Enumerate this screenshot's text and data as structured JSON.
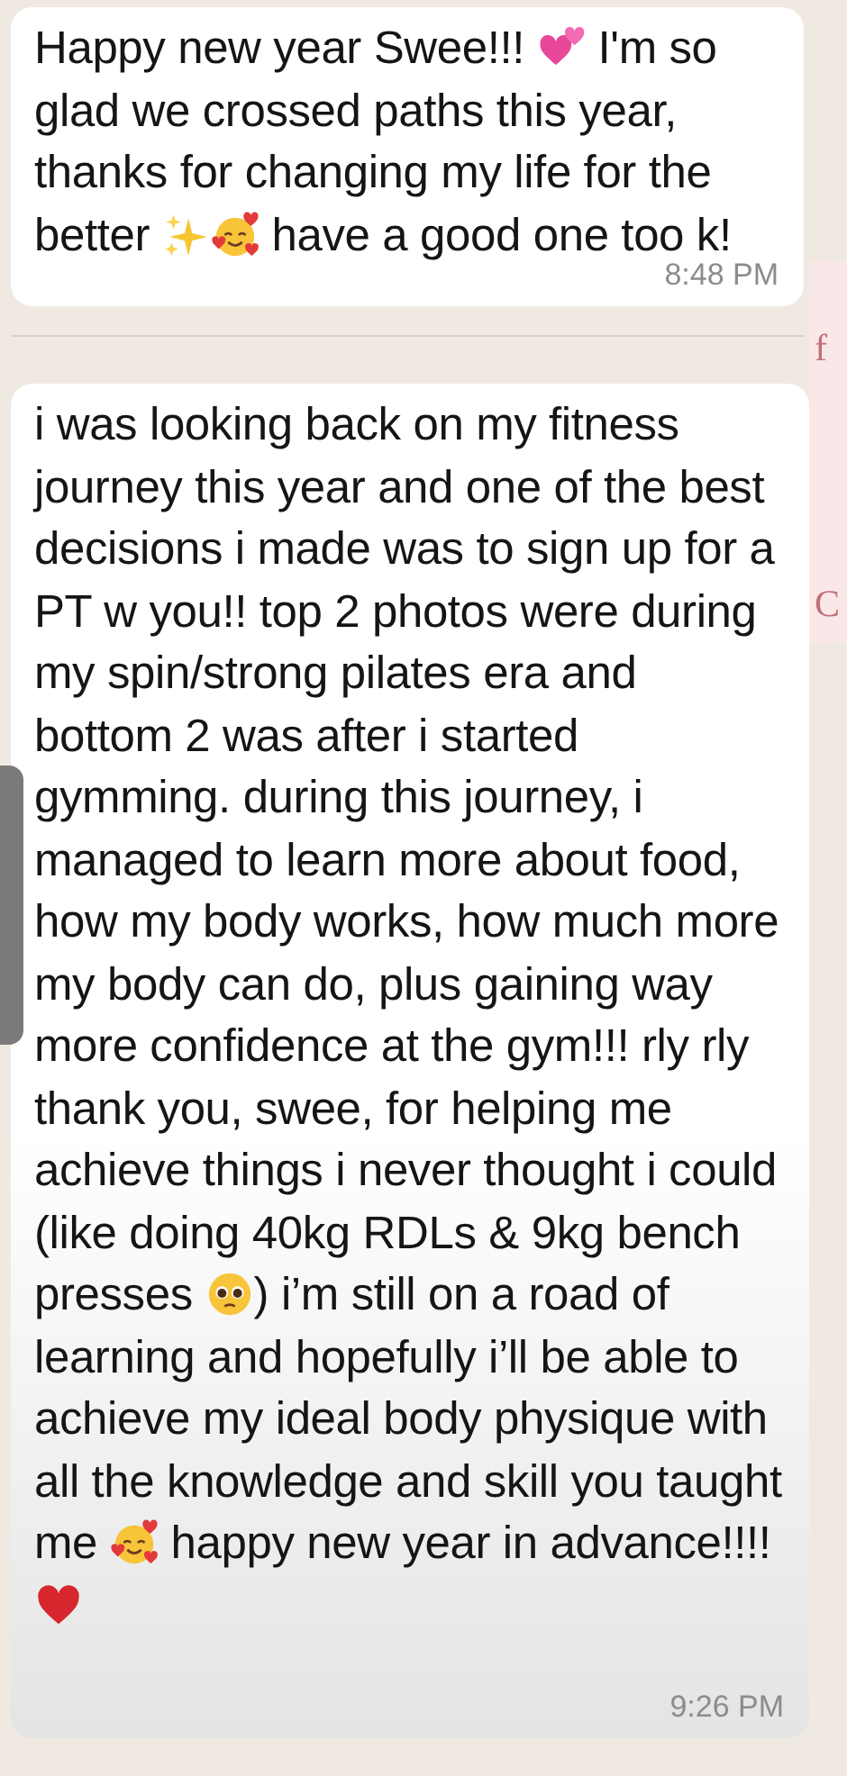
{
  "messages": [
    {
      "segments": [
        {
          "kind": "text",
          "text": "Happy new year Swee!!! "
        },
        {
          "kind": "two-hearts"
        },
        {
          "kind": "text",
          "text": " I'm so glad we crossed paths this year, thanks for changing my life for the better "
        },
        {
          "kind": "sparkles"
        },
        {
          "kind": "smiling-face"
        },
        {
          "kind": "text",
          "text": " have a good one too k!"
        }
      ],
      "time": "8:48 PM"
    },
    {
      "segments": [
        {
          "kind": "text",
          "text": "i was looking back on my fitness journey this year and one of the best decisions i made was to sign up for a PT w you!! top 2 photos were during my spin/strong pilates era and bottom 2 was after i started gymming. during this journey, i managed to learn more about food, how my body works, how much more my body can do, plus gaining way more confidence at the gym!!! rly rly thank you, swee, for helping me achieve things i never thought i could (like doing 40kg RDLs & 9kg bench presses "
        },
        {
          "kind": "pleading-face"
        },
        {
          "kind": "text",
          "text": ") i’m still on a road of learning and hopefully i’ll be able to achieve my ideal body physique with all the knowledge and skill you taught me "
        },
        {
          "kind": "smiling-face"
        },
        {
          "kind": "text",
          "text": " happy new year in advance!!!! "
        },
        {
          "kind": "heart"
        }
      ],
      "time": "9:26 PM"
    }
  ],
  "edge_letters": [
    "f",
    "C"
  ]
}
